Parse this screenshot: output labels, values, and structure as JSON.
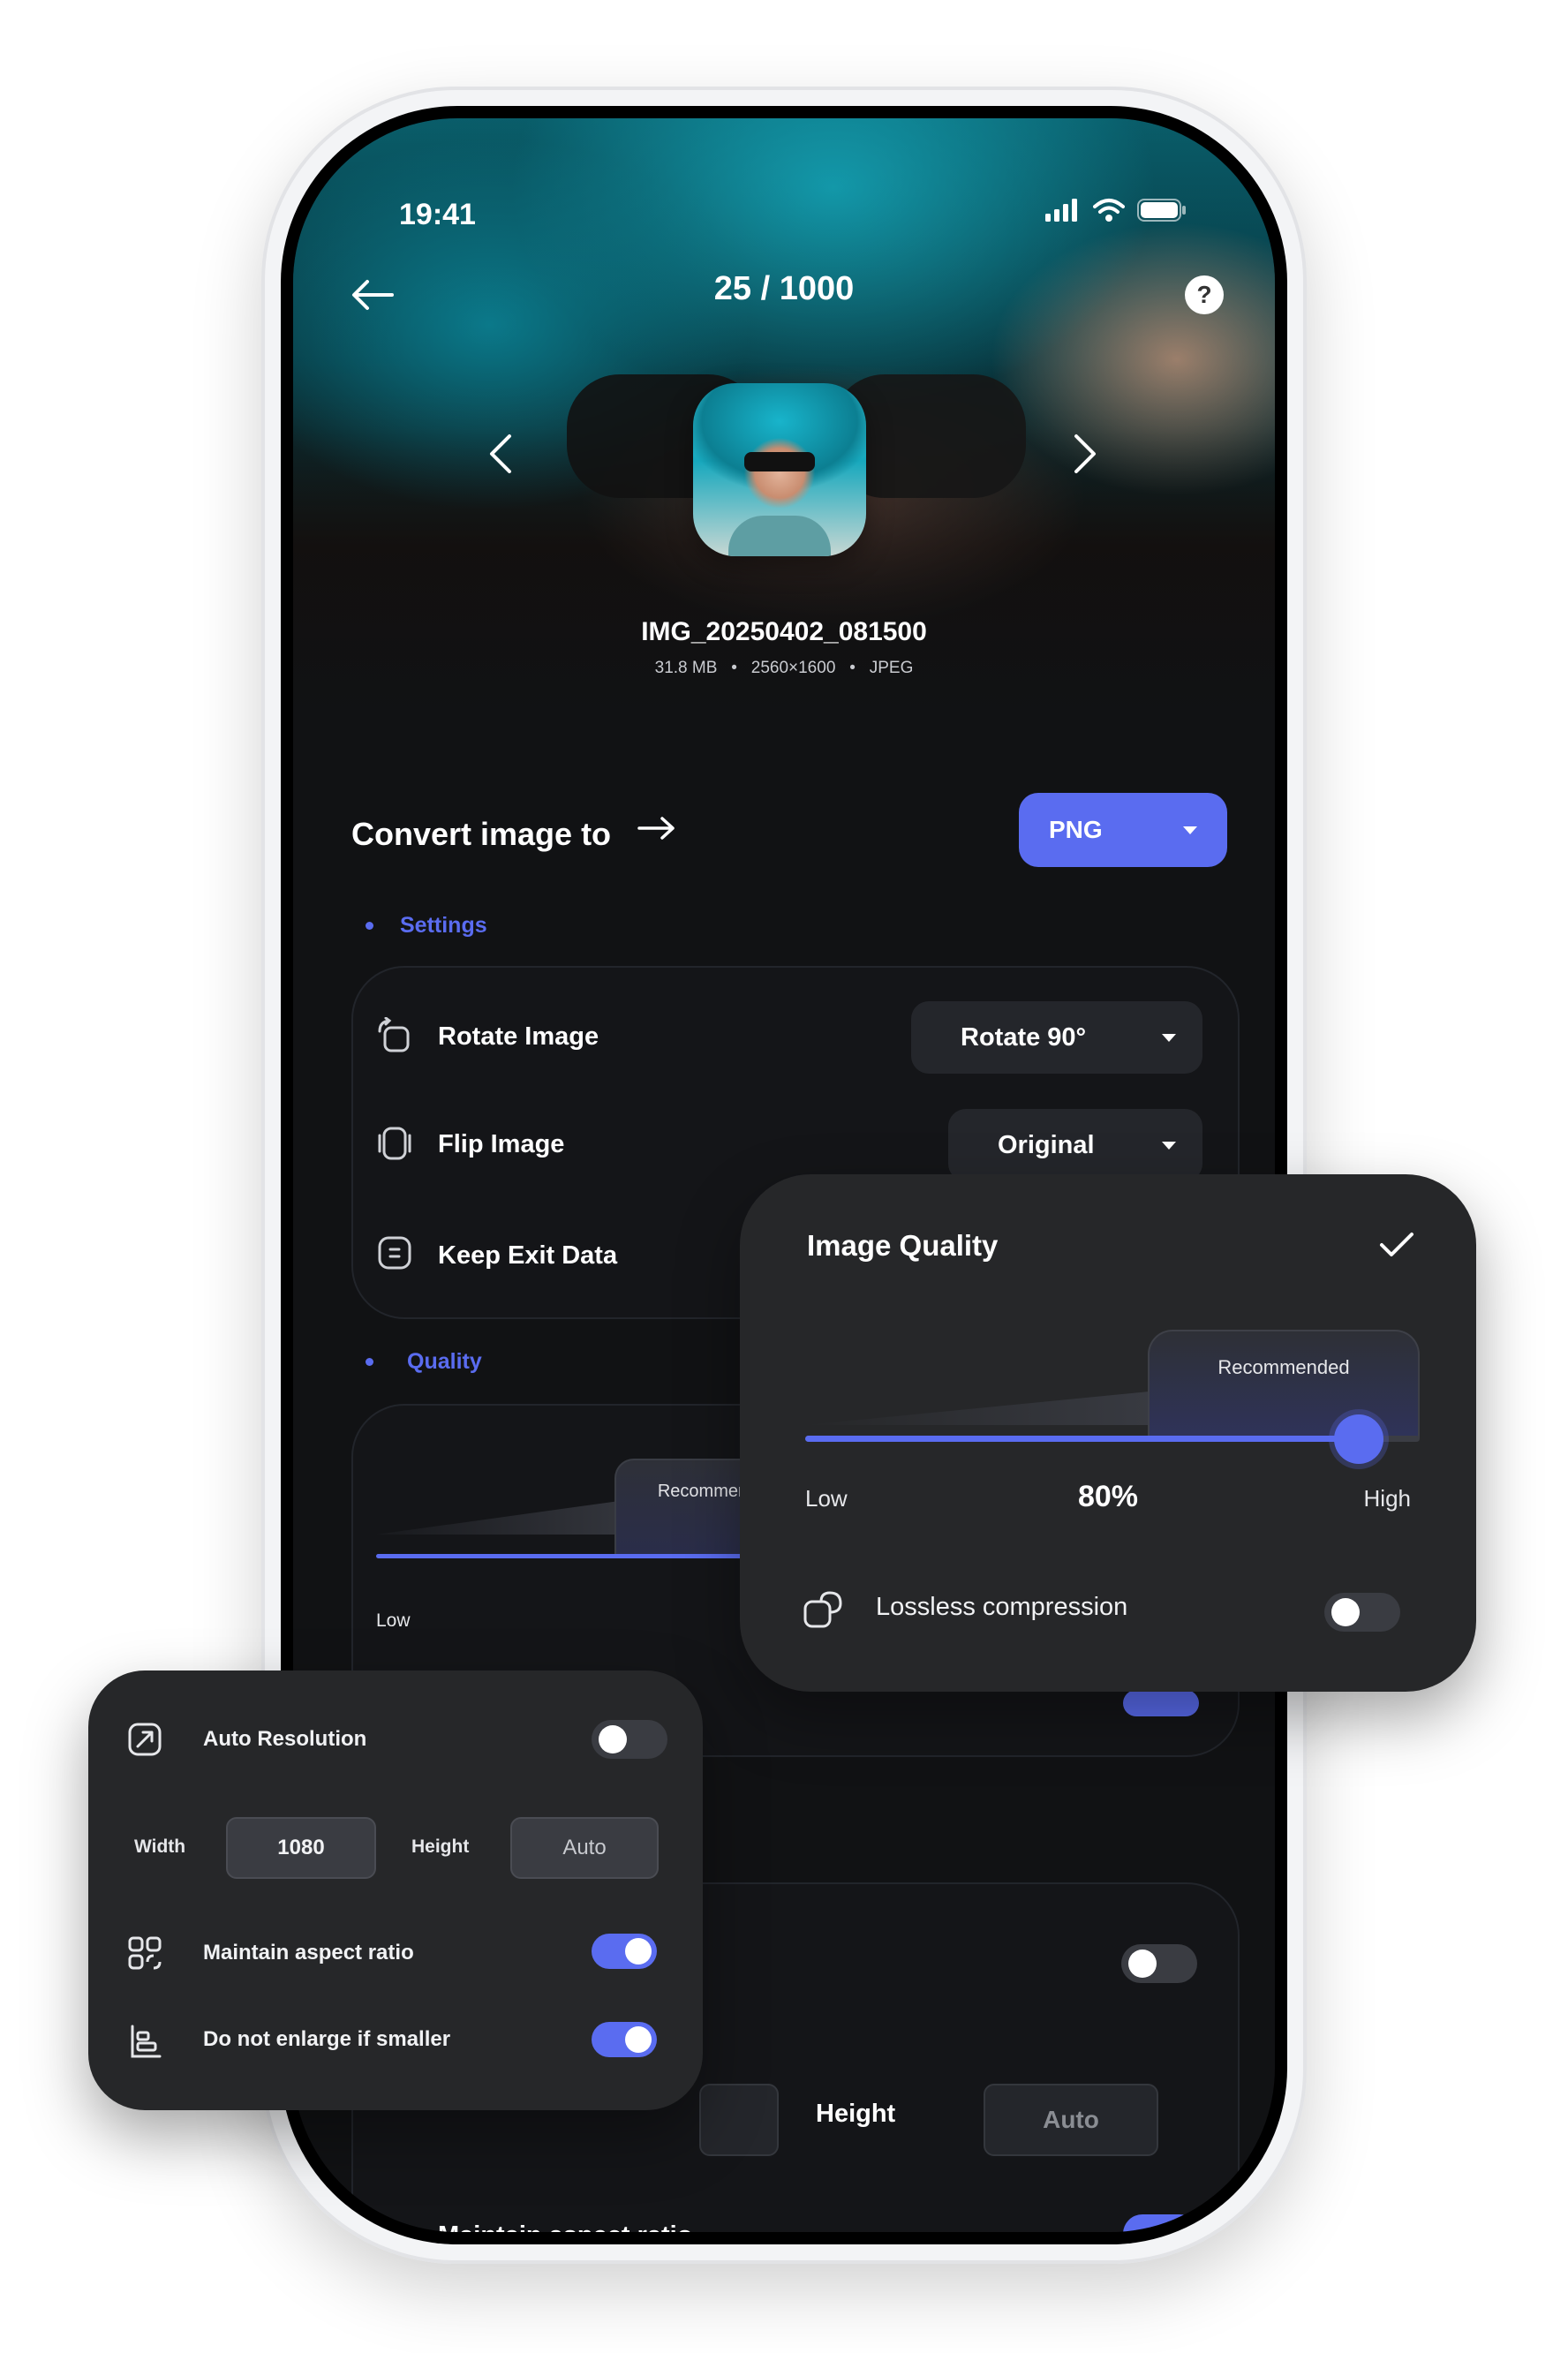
{
  "status": {
    "time": "19:41"
  },
  "nav": {
    "counter": "25 / 1000",
    "help": "?"
  },
  "file": {
    "name": "IMG_20250402_081500",
    "size": "31.8 MB",
    "dimensions": "2560×1600",
    "type": "JPEG",
    "separator": "•"
  },
  "convert": {
    "label": "Convert image to",
    "format": "PNG"
  },
  "settings": {
    "section_label": "Settings",
    "rotate": {
      "label": "Rotate Image",
      "value": "Rotate 90°"
    },
    "flip": {
      "label": "Flip Image",
      "value": "Original"
    },
    "exif": {
      "label": "Keep Exit Data"
    }
  },
  "quality": {
    "section_label": "Quality",
    "recommended_label": "Recommen",
    "low_label": "Low"
  },
  "resolution_bg": {
    "height_label": "Height",
    "height_value": "Auto",
    "aspect_label": "Maintain aspect ratio"
  },
  "image_quality_card": {
    "title": "Image Quality",
    "recommended": "Recommended",
    "low": "Low",
    "high": "High",
    "value_text": "80%",
    "value_fraction": 0.8,
    "lossless_label": "Lossless compression",
    "lossless_on": false
  },
  "auto_resolution_card": {
    "auto_label": "Auto Resolution",
    "auto_on": false,
    "width_label": "Width",
    "width_value": "1080",
    "height_label": "Height",
    "height_value": "Auto",
    "aspect_label": "Maintain aspect ratio",
    "aspect_on": true,
    "no_enlarge_label": "Do not enlarge if smaller",
    "no_enlarge_on": true
  },
  "colors": {
    "accent": "#5A6CF0",
    "background": "#111214",
    "card": "#262729"
  },
  "icons": [
    "back-arrow-icon",
    "help-icon",
    "chevron-left-icon",
    "chevron-right-icon",
    "arrow-right-icon",
    "caret-down-icon",
    "rotate-icon",
    "flip-icon",
    "exif-icon",
    "check-icon",
    "lossless-icon",
    "resize-icon",
    "aspect-ratio-icon",
    "align-icon",
    "signal-icon",
    "wifi-icon",
    "battery-icon"
  ]
}
